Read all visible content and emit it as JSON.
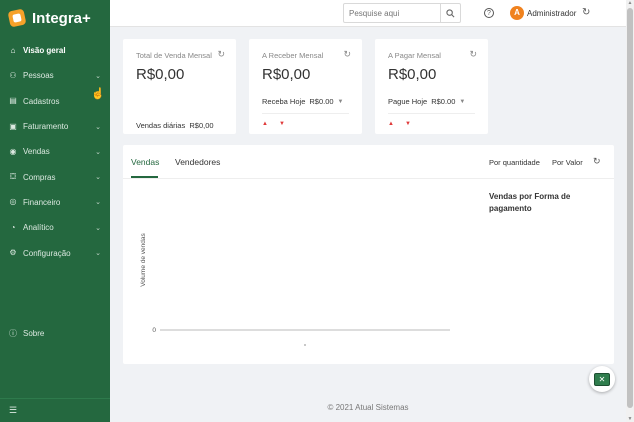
{
  "brand": {
    "name": "Integra+"
  },
  "sidebar": {
    "items": [
      {
        "label": "Visão geral",
        "icon": "home-icon",
        "glyph": "⌂",
        "has_children": false,
        "active": true
      },
      {
        "label": "Pessoas",
        "icon": "person-icon",
        "glyph": "⚇",
        "has_children": true,
        "active": false
      },
      {
        "label": "Cadastros",
        "icon": "clipboard-icon",
        "glyph": "▤",
        "has_children": false,
        "active": false
      },
      {
        "label": "Faturamento",
        "icon": "invoice-icon",
        "glyph": "▣",
        "has_children": true,
        "active": false
      },
      {
        "label": "Vendas",
        "icon": "dollar-icon",
        "glyph": "◉",
        "has_children": true,
        "active": false
      },
      {
        "label": "Compras",
        "icon": "cart-icon",
        "glyph": "⛋",
        "has_children": true,
        "active": false
      },
      {
        "label": "Financeiro",
        "icon": "money-icon",
        "glyph": "◎",
        "has_children": true,
        "active": false
      },
      {
        "label": "Analítico",
        "icon": "chart-icon",
        "glyph": "◔",
        "has_children": true,
        "active": false
      },
      {
        "label": "Configuração",
        "icon": "gear-icon",
        "glyph": "⚙",
        "has_children": true,
        "active": false
      }
    ],
    "sobre": {
      "label": "Sobre",
      "icon": "info-icon",
      "glyph": "ⓘ"
    },
    "collapse_icon": "menu-collapse-icon"
  },
  "topbar": {
    "search_placeholder": "Pesquise aqui",
    "user_initial": "A",
    "user_name": "Administrador"
  },
  "cards": [
    {
      "title": "Total de Venda Mensal",
      "value": "R$0,00",
      "footer_label": "Vendas diárias",
      "footer_value": "R$0,00"
    },
    {
      "title": "A Receber Mensal",
      "value": "R$0,00",
      "sub_label": "Receba Hoje",
      "sub_value": "R$0.00"
    },
    {
      "title": "A Pagar Mensal",
      "value": "R$0,00",
      "sub_label": "Pague Hoje",
      "sub_value": "R$0.00"
    }
  ],
  "panel": {
    "tabs": [
      "Vendas",
      "Vendedores"
    ],
    "active_tab": "Vendas",
    "options": [
      "Por quantidade",
      "Por Valor"
    ],
    "side_title": "Vendas por Forma de pagamento"
  },
  "chart_data": {
    "type": "bar",
    "categories": [
      ""
    ],
    "values": [
      0
    ],
    "title": "",
    "xlabel": "",
    "ylabel": "Volume de vendas",
    "ytick_labels": [
      "0"
    ],
    "ylim": [
      0,
      0
    ],
    "grid": false
  },
  "footer": {
    "text": "© 2021 Atual Sistemas"
  },
  "colors": {
    "sidebar": "#24683f",
    "accent": "#24683f",
    "avatar": "#f0821e",
    "logo": "#f6a22a",
    "trend": "#e03a3a"
  }
}
